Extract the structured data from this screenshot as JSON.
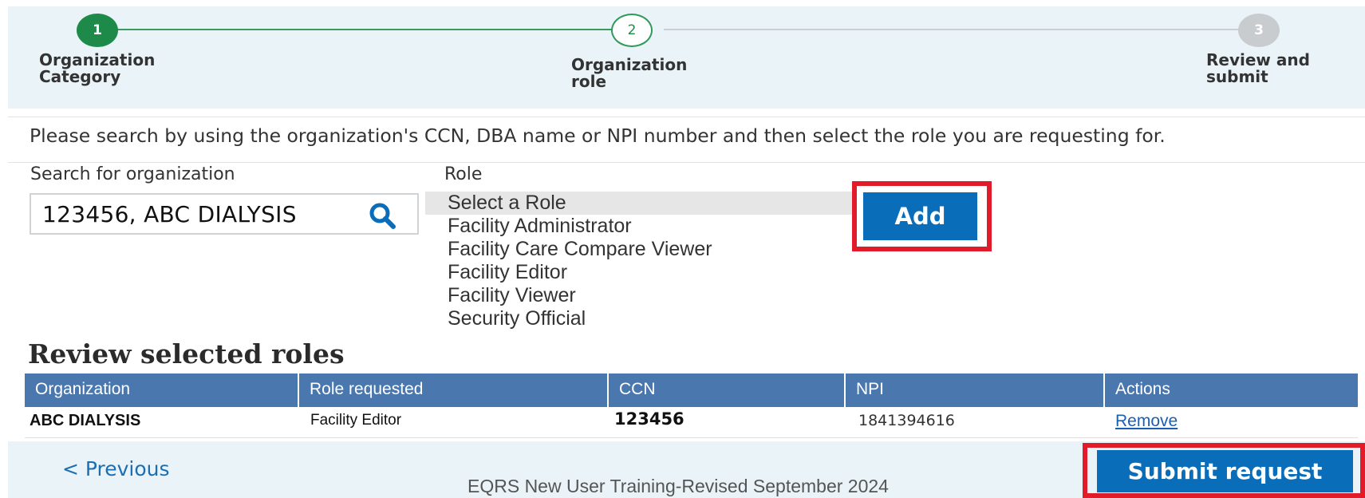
{
  "stepper": {
    "steps": [
      {
        "number": "1",
        "label_line1": "Organization",
        "label_line2": "Category",
        "state": "complete"
      },
      {
        "number": "2",
        "label_line1": "Organization",
        "label_line2": "role",
        "state": "current"
      },
      {
        "number": "3",
        "label_line1": "Review and",
        "label_line2": "submit",
        "state": "pending"
      }
    ]
  },
  "form": {
    "instruction": "Please search by using the organization's CCN, DBA name or NPI number and then select the role you are requesting for.",
    "search_label": "Search for organization",
    "search_value": "123456, ABC DIALYSIS",
    "search_icon": "search-icon",
    "role_label": "Role",
    "role_options": [
      "Select a Role",
      "Facility Administrator",
      "Facility Care Compare Viewer",
      "Facility Editor",
      "Facility Viewer",
      "Security Official"
    ],
    "add_label": "Add"
  },
  "review": {
    "title": "Review selected roles",
    "columns": [
      "Organization",
      "Role requested",
      "CCN",
      "NPI",
      "Actions"
    ],
    "rows": [
      {
        "organization": "ABC DIALYSIS",
        "role": "Facility Editor",
        "ccn": "123456",
        "npi": "1841394616",
        "action": "Remove"
      }
    ]
  },
  "footer": {
    "previous_label": "< Previous",
    "submit_label": "Submit request",
    "note": "EQRS New User Training-Revised September 2024"
  },
  "colors": {
    "accent_blue": "#0a6db9",
    "header_blue": "#4a77ad",
    "step_green": "#1e8a4a",
    "highlight_red": "#e21b2a"
  }
}
